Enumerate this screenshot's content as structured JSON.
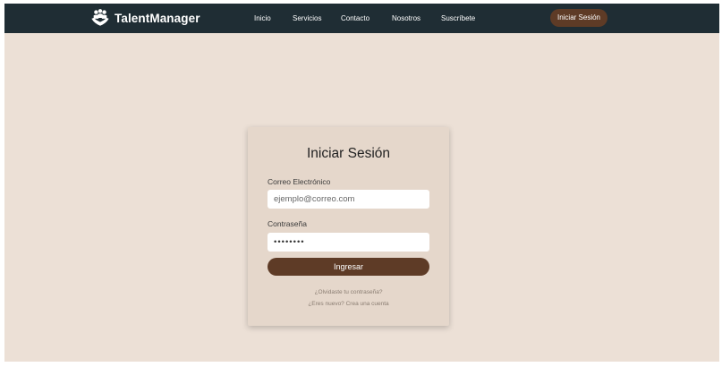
{
  "navbar": {
    "brand_name": "TalentManager",
    "brand_icon": "team-hands-icon",
    "links": [
      "Inicio",
      "Servicios",
      "Contacto",
      "Nosotros",
      "Suscríbete"
    ],
    "login_button": "Iniciar Sesión",
    "background_color": "#1f2d34"
  },
  "login_form": {
    "title": "Iniciar Sesión",
    "email_label": "Correo Electrónico",
    "email_placeholder": "ejemplo@correo.com",
    "password_label": "Contraseña",
    "password_value": "••••••••",
    "submit_label": "Ingresar",
    "forgot_password": "¿Olvidaste tu contraseña?",
    "signup_prompt": "¿Eres nuevo? Crea una cuenta"
  },
  "colors": {
    "page_background": "#ece0d6",
    "card_background": "#e5d7cb",
    "accent_brown": "#5e3b26"
  }
}
